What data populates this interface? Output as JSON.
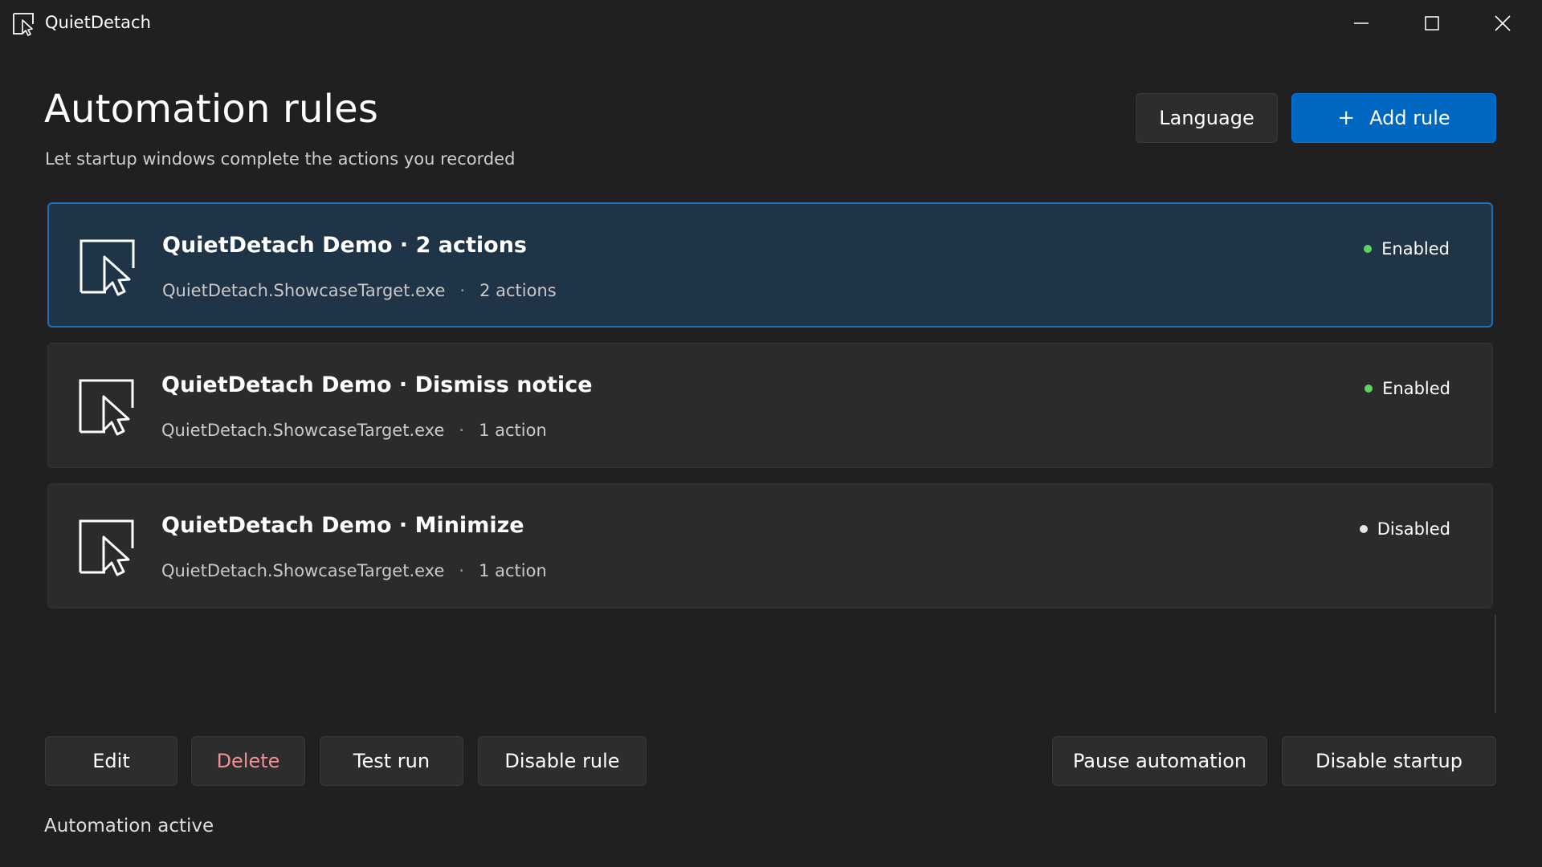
{
  "window": {
    "title": "QuietDetach",
    "icon": "app-pointer-icon",
    "controls": [
      "minimize-icon",
      "maximize-icon",
      "close-icon"
    ]
  },
  "header": {
    "title": "Automation rules",
    "subtitle": "Let startup windows complete the actions you recorded",
    "language_label": "Language",
    "add_rule_label": "Add rule",
    "add_rule_icon": "plus-icon"
  },
  "rules": [
    {
      "name": "QuietDetach Demo · 2 actions",
      "executable": "QuietDetach.ShowcaseTarget.exe",
      "separator": "·",
      "actions": "2 actions",
      "status": "Enabled",
      "status_color": "#5fd35f",
      "selected": true,
      "icon": "window-pointer-icon"
    },
    {
      "name": "QuietDetach Demo · Dismiss notice",
      "executable": "QuietDetach.ShowcaseTarget.exe",
      "separator": "·",
      "actions": "1 action",
      "status": "Enabled",
      "status_color": "#5fd35f",
      "selected": false,
      "icon": "window-pointer-icon"
    },
    {
      "name": "QuietDetach Demo · Minimize",
      "executable": "QuietDetach.ShowcaseTarget.exe",
      "separator": "·",
      "actions": "1 action",
      "status": "Disabled",
      "status_color": "#e6e6e6",
      "selected": false,
      "icon": "window-pointer-icon"
    }
  ],
  "toolbar": {
    "edit_label": "Edit",
    "delete_label": "Delete",
    "test_run_label": "Test run",
    "disable_rule_label": "Disable rule",
    "pause_label": "Pause automation",
    "disable_startup_label": "Disable startup"
  },
  "status_text": "Automation active",
  "colors": {
    "background": "#202020",
    "accent": "#0067c0",
    "selected_card": "#1f3447",
    "danger_text": "#f08f9a"
  }
}
